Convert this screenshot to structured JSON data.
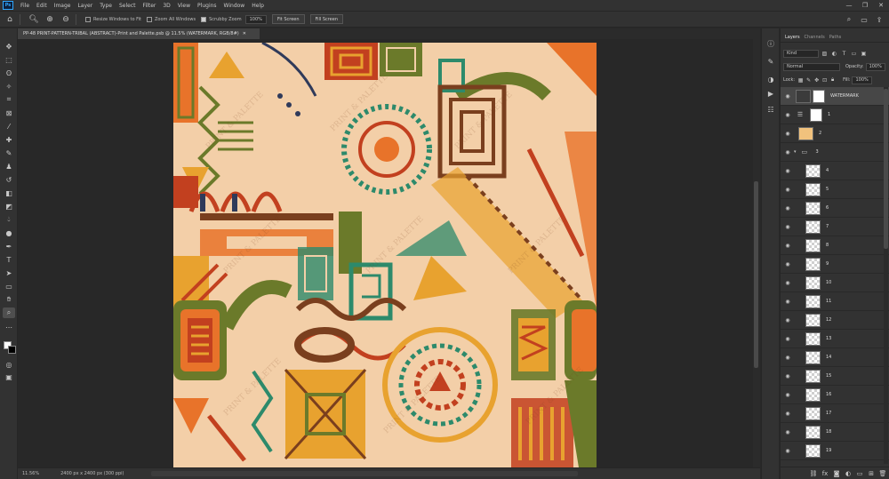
{
  "app": {
    "logo": "Ps",
    "menu": [
      "File",
      "Edit",
      "Image",
      "Layer",
      "Type",
      "Select",
      "Filter",
      "3D",
      "View",
      "Plugins",
      "Window",
      "Help"
    ],
    "window_controls": [
      "—",
      "❐",
      "✕"
    ]
  },
  "options_bar": {
    "resize_windows_label": "Resize Windows to Fit",
    "zoom_all_windows_label": "Zoom All Windows",
    "scrubby_zoom_label": "Scrubby Zoom",
    "zoom_value": "100%",
    "fit_screen_label": "Fit Screen",
    "fill_screen_label": "Fill Screen"
  },
  "document": {
    "tab_title": "PP-48 PRINT-PATTERN-TRIBAL (ABSTRACT)-Print and Palette.psb @ 11.5% (WATERMARK, RGB/8#)",
    "tab_close": "✕"
  },
  "status_bar": {
    "zoom": "11.56%",
    "info": "2400 px x 2400 px (300 ppi)"
  },
  "layers_panel": {
    "tabs": [
      "Layers",
      "Channels",
      "Paths"
    ],
    "filter_kind": "Kind",
    "blend_mode": "Normal",
    "opacity_label": "Opacity:",
    "opacity_value": "100%",
    "lock_label": "Lock:",
    "fill_label": "Fill:",
    "fill_value": "100%",
    "layers": [
      {
        "name": "WATERMARK",
        "type": "smart-mask",
        "selected": true
      },
      {
        "name": "1",
        "type": "adjustment"
      },
      {
        "name": "2",
        "type": "fill"
      },
      {
        "name": "3",
        "type": "group"
      },
      {
        "name": "4",
        "type": "pixel"
      },
      {
        "name": "5",
        "type": "pixel"
      },
      {
        "name": "6",
        "type": "pixel"
      },
      {
        "name": "7",
        "type": "pixel"
      },
      {
        "name": "8",
        "type": "pixel"
      },
      {
        "name": "9",
        "type": "pixel"
      },
      {
        "name": "10",
        "type": "pixel"
      },
      {
        "name": "11",
        "type": "pixel"
      },
      {
        "name": "12",
        "type": "pixel"
      },
      {
        "name": "13",
        "type": "pixel"
      },
      {
        "name": "14",
        "type": "pixel"
      },
      {
        "name": "15",
        "type": "pixel"
      },
      {
        "name": "16",
        "type": "pixel"
      },
      {
        "name": "17",
        "type": "pixel"
      },
      {
        "name": "18",
        "type": "pixel"
      },
      {
        "name": "19",
        "type": "pixel"
      }
    ]
  },
  "colors": {
    "pattern_background": "#f3cfa8",
    "orange": "#e8732a",
    "red": "#c2401f",
    "yellow": "#e8a22f",
    "green": "#6b7a2a",
    "teal": "#2d8a6b",
    "navy": "#2f3a5a",
    "brown": "#7a3f1e"
  },
  "icons": {
    "home": "home-icon",
    "zoom": "zoom-icon",
    "search": "search-icon",
    "workspace": "workspace-icon",
    "share": "share-icon"
  }
}
